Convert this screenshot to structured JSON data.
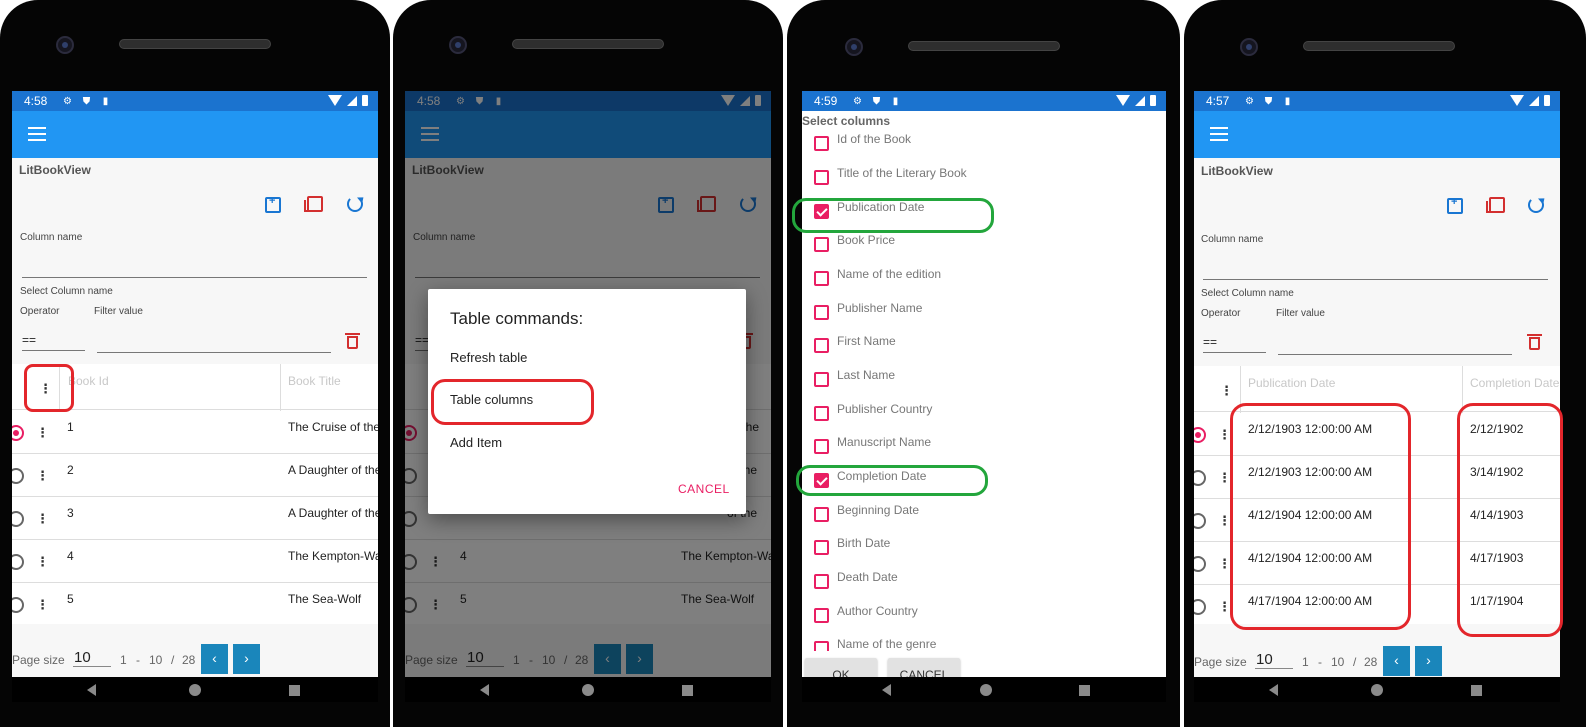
{
  "status_bar": {
    "time1": "4:58",
    "time2": "4:58",
    "time3": "4:59",
    "time4": "4:57"
  },
  "page_title": "LitBookView",
  "filter": {
    "column_name_label": "Column name",
    "select_column_label": "Select Column name",
    "operator_label": "Operator",
    "filter_value_label": "Filter value",
    "operator_value": "=="
  },
  "grid1": {
    "headers": [
      "Book Id",
      "Book Title"
    ],
    "rows": [
      {
        "id": "1",
        "title": "The Cruise of the"
      },
      {
        "id": "2",
        "title": "A Daughter of the"
      },
      {
        "id": "3",
        "title": "A Daughter of the"
      },
      {
        "id": "4",
        "title": "The Kempton-Wa"
      },
      {
        "id": "5",
        "title": "The Sea-Wolf"
      }
    ]
  },
  "grid2": {
    "headers": [
      "",
      ""
    ],
    "rows": [
      {
        "id": "",
        "title": "e of the"
      },
      {
        "id": "",
        "title": "of the"
      },
      {
        "id": "",
        "title": "of the"
      },
      {
        "id": "4",
        "title": "The Kempton-Wa"
      },
      {
        "id": "5",
        "title": "The Sea-Wolf"
      }
    ]
  },
  "grid4": {
    "headers": [
      "Publication Date",
      "Completion Date"
    ],
    "rows": [
      {
        "pub": "2/12/1903 12:00:00 AM",
        "comp": "2/12/1902"
      },
      {
        "pub": "2/12/1903 12:00:00 AM",
        "comp": "3/14/1902"
      },
      {
        "pub": "4/12/1904 12:00:00 AM",
        "comp": "4/14/1903"
      },
      {
        "pub": "4/12/1904 12:00:00 AM",
        "comp": "4/17/1903"
      },
      {
        "pub": "4/17/1904 12:00:00 AM",
        "comp": "1/17/1904"
      }
    ]
  },
  "pager": {
    "label": "Page size",
    "size": "10",
    "from": "1",
    "dash": "-",
    "to": "10",
    "slash": "/",
    "total": "28",
    "prev": "‹",
    "next": "›"
  },
  "dialog": {
    "title": "Table commands:",
    "items": [
      "Refresh table",
      "Table columns",
      "Add Item"
    ],
    "cancel": "CANCEL"
  },
  "column_picker": {
    "title": "Select columns",
    "columns": [
      {
        "label": "Id of the Book",
        "checked": false
      },
      {
        "label": "Title of the Literary Book",
        "checked": false
      },
      {
        "label": "Publication Date",
        "checked": true
      },
      {
        "label": "Book Price",
        "checked": false
      },
      {
        "label": "Name of the edition",
        "checked": false
      },
      {
        "label": "Publisher Name",
        "checked": false
      },
      {
        "label": "First Name",
        "checked": false
      },
      {
        "label": "Last Name",
        "checked": false
      },
      {
        "label": "Publisher Country",
        "checked": false
      },
      {
        "label": "Manuscript Name",
        "checked": false
      },
      {
        "label": "Completion Date",
        "checked": true
      },
      {
        "label": "Beginning Date",
        "checked": false
      },
      {
        "label": "Birth Date",
        "checked": false
      },
      {
        "label": "Death Date",
        "checked": false
      },
      {
        "label": "Author Country",
        "checked": false
      },
      {
        "label": "Name of the genre",
        "checked": false
      }
    ],
    "ok": "OK",
    "cancel": "CANCEL"
  },
  "colors": {
    "appbar": "#2196f3",
    "statusbar": "#1b73cf",
    "accent": "#e91e63",
    "pager_button": "#1a86bb",
    "highlight_red": "#e3262b",
    "highlight_green": "#23a63c"
  },
  "icons": [
    "menu-icon",
    "add-item-icon",
    "copy-icon",
    "refresh-icon",
    "delete-icon",
    "kebab-icon",
    "settings-icon",
    "shield-icon",
    "sd-card-icon",
    "wifi-icon",
    "signal-icon",
    "battery-icon"
  ]
}
